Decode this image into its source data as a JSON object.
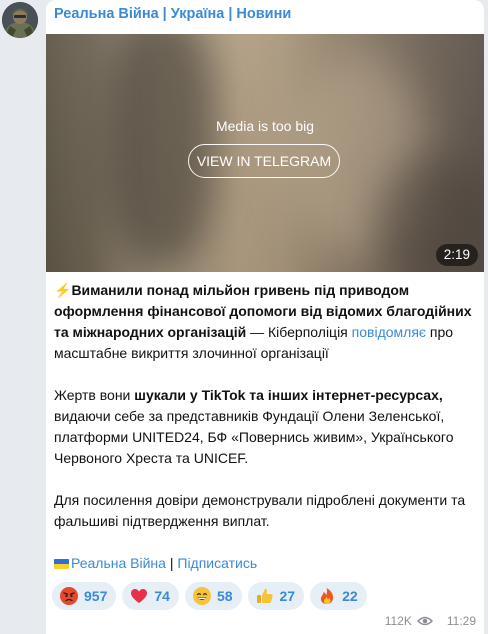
{
  "channel": {
    "name": "Реальна Війна | Україна | Новини"
  },
  "media": {
    "notice": "Media is too big",
    "button_label": "VIEW IN TELEGRAM",
    "duration": "2:19"
  },
  "post": {
    "bolt": "⚡",
    "headline": "Виманили понад мільйон гривень під приводом оформлення фінансової допомоги від відомих благодійних та міжнародних організацій",
    "dash": " — Кіберполіція ",
    "link": "повідомляє",
    "lead_rest": " про масштабне викриття злочинної організації",
    "p2_a": "Жертв вони ",
    "p2_bold": "шукали у TikTok та інших інтернет-ресурсах,",
    "p2_b": " видаючи себе за представників Фундації Олени Зеленської, платформи UNITED24, БФ «Повернись живим», Українського Червоного Хреста та UNICEF.",
    "p3": "Для посилення довіри демонстрували підроблені документи та фальшиві підтвердження виплат.",
    "footer_channel": "Реальна Війна",
    "footer_sep": " | ",
    "footer_subscribe": "Підписатись"
  },
  "reactions": [
    {
      "icon": "angry-face-icon",
      "count": "957"
    },
    {
      "icon": "heart-icon",
      "count": "74"
    },
    {
      "icon": "grin-face-icon",
      "count": "58"
    },
    {
      "icon": "thumbs-up-icon",
      "count": "27"
    },
    {
      "icon": "fire-icon",
      "count": "22"
    }
  ],
  "meta": {
    "views": "112K",
    "time": "11:29"
  },
  "colors": {
    "accent": "#3a8ad4",
    "background": "#e7ebf0",
    "bubble": "#ffffff",
    "reaction_bg": "#e6eef6"
  }
}
